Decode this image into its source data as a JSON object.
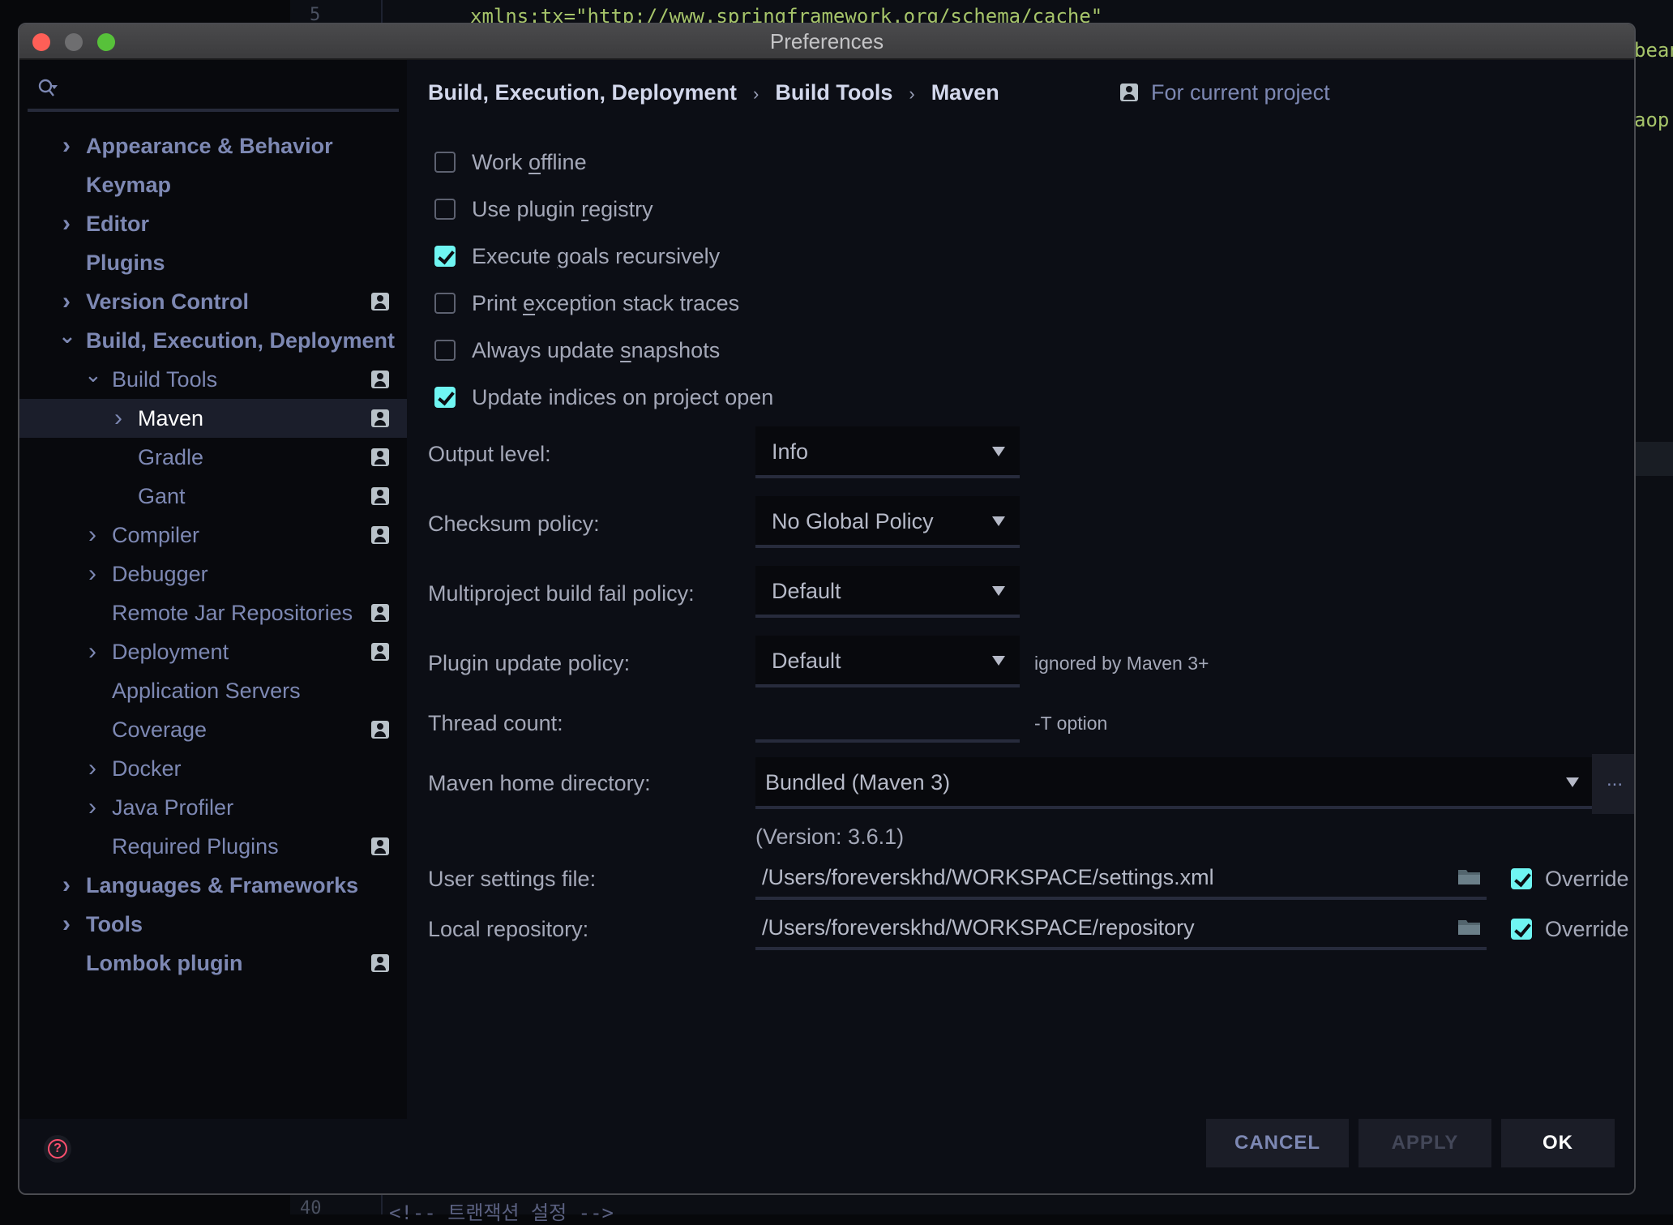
{
  "background_editor": {
    "line_top_number": "5",
    "line_top_code": "xmlns:tx=\"http://www.springframework.org/schema/cache\"",
    "right_fragment_1": "bean",
    "right_fragment_2": "aop",
    "line_bottom_number": "40",
    "line_bottom_code": "<!--      트랜잭션 설정 -->"
  },
  "window": {
    "title": "Preferences"
  },
  "search": {
    "placeholder": "",
    "value": ""
  },
  "sidebar": {
    "items": [
      {
        "label": "Appearance & Behavior",
        "level": 0,
        "bold": true,
        "chevron": "right",
        "project": false
      },
      {
        "label": "Keymap",
        "level": 0,
        "bold": true,
        "chevron": "none",
        "project": false
      },
      {
        "label": "Editor",
        "level": 0,
        "bold": true,
        "chevron": "right",
        "project": false
      },
      {
        "label": "Plugins",
        "level": 0,
        "bold": true,
        "chevron": "none",
        "project": false
      },
      {
        "label": "Version Control",
        "level": 0,
        "bold": true,
        "chevron": "right",
        "project": true
      },
      {
        "label": "Build, Execution, Deployment",
        "level": 0,
        "bold": true,
        "chevron": "down",
        "project": false
      },
      {
        "label": "Build Tools",
        "level": 1,
        "bold": false,
        "chevron": "down",
        "project": true
      },
      {
        "label": "Maven",
        "level": 2,
        "bold": false,
        "chevron": "right",
        "project": true,
        "selected": true
      },
      {
        "label": "Gradle",
        "level": 2,
        "bold": false,
        "chevron": "none",
        "project": true
      },
      {
        "label": "Gant",
        "level": 2,
        "bold": false,
        "chevron": "none",
        "project": true
      },
      {
        "label": "Compiler",
        "level": 1,
        "bold": false,
        "chevron": "right",
        "project": true
      },
      {
        "label": "Debugger",
        "level": 1,
        "bold": false,
        "chevron": "right",
        "project": false
      },
      {
        "label": "Remote Jar Repositories",
        "level": 1,
        "bold": false,
        "chevron": "none",
        "project": true
      },
      {
        "label": "Deployment",
        "level": 1,
        "bold": false,
        "chevron": "right",
        "project": true
      },
      {
        "label": "Application Servers",
        "level": 1,
        "bold": false,
        "chevron": "none",
        "project": false
      },
      {
        "label": "Coverage",
        "level": 1,
        "bold": false,
        "chevron": "none",
        "project": true
      },
      {
        "label": "Docker",
        "level": 1,
        "bold": false,
        "chevron": "right",
        "project": false
      },
      {
        "label": "Java Profiler",
        "level": 1,
        "bold": false,
        "chevron": "right",
        "project": false
      },
      {
        "label": "Required Plugins",
        "level": 1,
        "bold": false,
        "chevron": "none",
        "project": true
      },
      {
        "label": "Languages & Frameworks",
        "level": 0,
        "bold": true,
        "chevron": "right",
        "project": false
      },
      {
        "label": "Tools",
        "level": 0,
        "bold": true,
        "chevron": "right",
        "project": false
      },
      {
        "label": "Lombok plugin",
        "level": 0,
        "bold": true,
        "chevron": "none",
        "project": true
      }
    ]
  },
  "breadcrumb": {
    "items": [
      "Build, Execution, Deployment",
      "Build Tools",
      "Maven"
    ],
    "separator": "›",
    "scope_label": "For current project"
  },
  "checkboxes": [
    {
      "pre": "Work ",
      "mnemonic": "o",
      "post": "ffline",
      "checked": false
    },
    {
      "pre": "Use plugin ",
      "mnemonic": "r",
      "post": "egistry",
      "checked": false
    },
    {
      "pre": "Execute ",
      "mnemonic": "g",
      "post": "oals recursively",
      "checked": true
    },
    {
      "pre": "Print ",
      "mnemonic": "e",
      "post": "xception stack traces",
      "checked": false
    },
    {
      "pre": "Always update ",
      "mnemonic": "s",
      "post": "napshots",
      "checked": false
    },
    {
      "pre": "Update indices on project open",
      "mnemonic": "",
      "post": "",
      "checked": true
    }
  ],
  "form": {
    "output_level": {
      "label": "Output level:",
      "value": "Info"
    },
    "checksum_policy": {
      "label": "Checksum policy:",
      "value": "No Global Policy"
    },
    "multiproject_fail_policy": {
      "label": "Multiproject build fail policy:",
      "value": "Default"
    },
    "plugin_update_policy": {
      "label": "Plugin update policy:",
      "value": "Default",
      "hint": "ignored by Maven 3+"
    },
    "thread_count": {
      "label": "Thread count:",
      "value": "",
      "hint": "-T option"
    },
    "maven_home": {
      "label": "Maven home directory:",
      "value": "Bundled (Maven 3)",
      "browse_label": "...",
      "version": "(Version: 3.6.1)"
    },
    "user_settings": {
      "label": "User settings file:",
      "value": "/Users/foreverskhd/WORKSPACE/settings.xml",
      "override_label": "Override",
      "override": true
    },
    "local_repository": {
      "label": "Local repository:",
      "value": "/Users/foreverskhd/WORKSPACE/repository",
      "override_label": "Override",
      "override": true
    }
  },
  "footer": {
    "help_glyph": "?",
    "cancel_label": "CANCEL",
    "apply_label": "APPLY",
    "ok_label": "OK"
  },
  "colors": {
    "accent_checkbox": "#6ff5f2",
    "help_icon": "#ff4f6e",
    "sidebar_text": "#7d88b3",
    "selected_row": "#1b1e2b"
  }
}
